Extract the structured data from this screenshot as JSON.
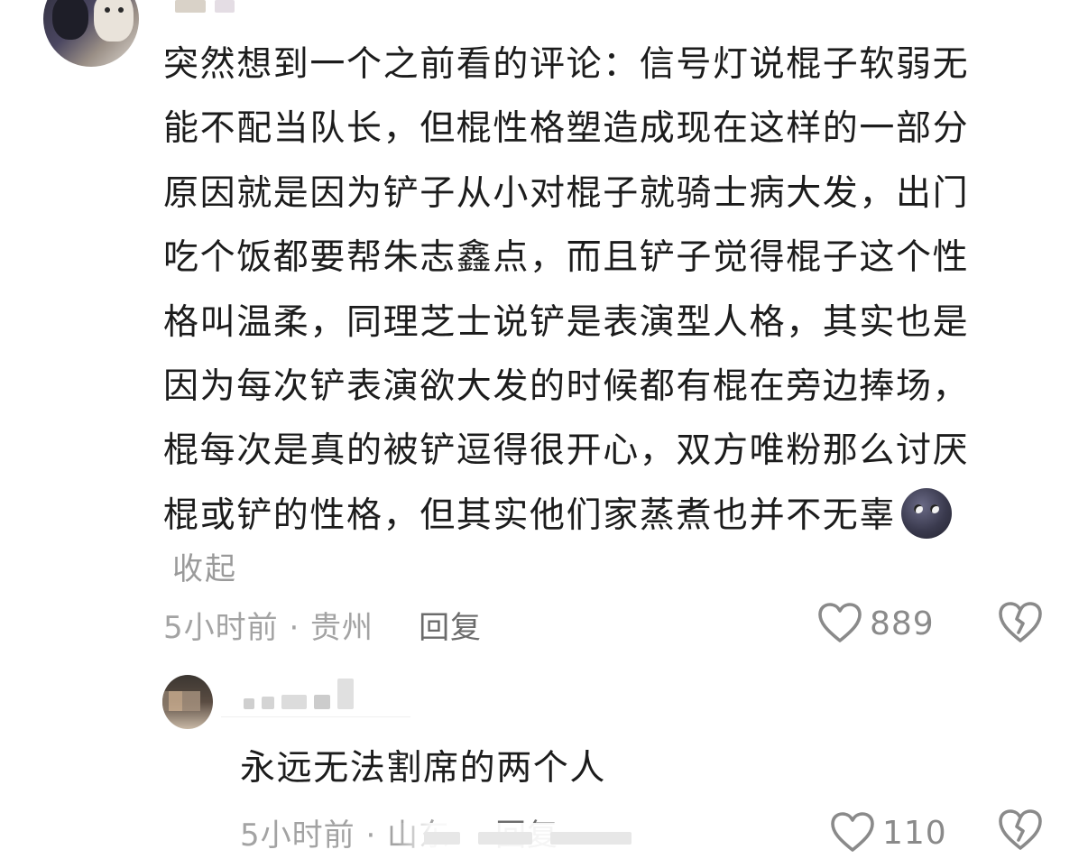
{
  "main_comment": {
    "lines": [
      "突然想到一个之前看的评论：信号灯说棍子软弱无",
      "能不配当队长，但棍性格塑造成现在这样的一部分",
      "原因就是因为铲子从小对棍子就骑士病大发，出门",
      "吃个饭都要帮朱志鑫点，而且铲子觉得棍子这个性",
      "格叫温柔，同理芝士说铲是表演型人格，其实也是",
      "因为每次铲表演欲大发的时候都有棍在旁边捧场，",
      "棍每次是真的被铲逗得很开心，双方唯粉那么讨厌",
      "棍或铲的性格，但其实他们家蒸煮也并不无辜"
    ],
    "emoji": "new-moon-face-emoji",
    "collapse_label": "收起",
    "time_location": "5小时前 · 贵州",
    "reply_label": "回复",
    "like_count": "889",
    "like_icon": "heart-outline-icon",
    "dislike_icon": "broken-heart-icon"
  },
  "reply_comment": {
    "text": "永远无法割席的两个人",
    "time_location": "5小时前 · 山东",
    "reply_label": "回复",
    "like_count": "110",
    "like_icon": "heart-outline-icon",
    "dislike_icon": "broken-heart-icon"
  },
  "colors": {
    "text_primary": "#1c1c1c",
    "text_muted": "#a3a3a3",
    "text_action": "#6b6b6b",
    "icon_gray": "#8a8a8a"
  }
}
